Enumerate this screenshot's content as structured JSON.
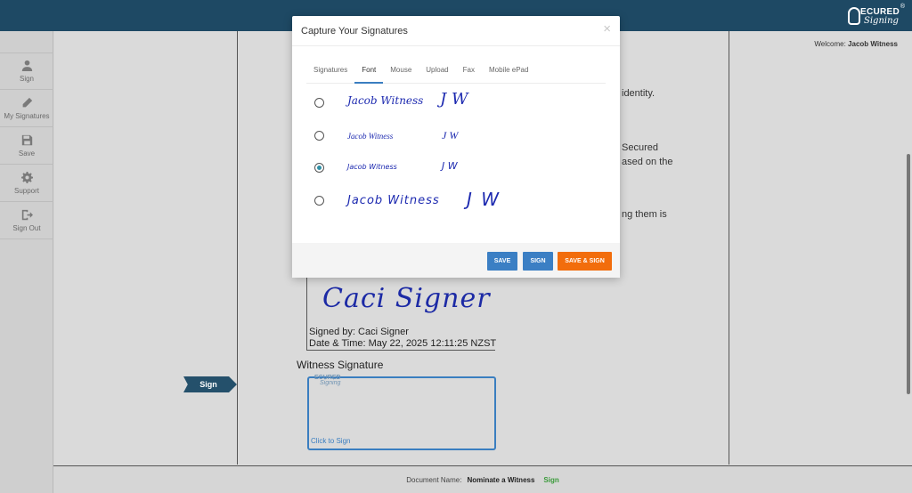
{
  "brand": {
    "logo_line1": "ECURED",
    "logo_line2": "Signing",
    "reg_mark": "®"
  },
  "sidebar": {
    "items": [
      {
        "label": "Sign",
        "icon": "user-icon"
      },
      {
        "label": "My Signatures",
        "icon": "pencil-icon"
      },
      {
        "label": "Save",
        "icon": "floppy-disk-icon"
      },
      {
        "label": "Support",
        "icon": "gear-icon"
      },
      {
        "label": "Sign Out",
        "icon": "sign-out-icon"
      }
    ]
  },
  "header": {
    "welcome_prefix": "Welcome:",
    "welcome_user": "Jacob Witness"
  },
  "document": {
    "text_fragments": [
      "identity.",
      "Secured",
      "ased on the",
      "ng them is"
    ],
    "signer_signature": "Caci Signer",
    "signed_by": "Signed by: Caci Signer",
    "date_time": "Date & Time: May 22, 2025 12:11:25 NZST",
    "witness_label": "Witness Signature",
    "witness_logo1": "ECURED",
    "witness_logo2": "Signing",
    "click_to_sign": "Click to Sign",
    "sign_tag": "Sign"
  },
  "footer": {
    "doc_name_label": "Document Name:",
    "doc_name": "Nominate a Witness",
    "status": "Sign"
  },
  "modal": {
    "title": "Capture Your Signatures",
    "close": "×",
    "tabs": [
      "Signatures",
      "Font",
      "Mouse",
      "Upload",
      "Fax",
      "Mobile ePad"
    ],
    "active_tab": "Font",
    "options": [
      {
        "name": "Jacob Witness",
        "initials": "J W",
        "checked": false
      },
      {
        "name": "Jacob Witness",
        "initials": "J W",
        "checked": false
      },
      {
        "name": "Jacob Witness",
        "initials": "J W",
        "checked": true
      },
      {
        "name": "Jacob Witness",
        "initials": "J W",
        "checked": false
      }
    ],
    "buttons": {
      "save": "SAVE",
      "sign": "SIGN",
      "save_sign": "SAVE & SIGN"
    }
  },
  "colors": {
    "topbar": "#1e4964",
    "accent_blue": "#3b7fc4",
    "accent_orange": "#f26d0c",
    "signature_blue": "#1d2ab0"
  }
}
